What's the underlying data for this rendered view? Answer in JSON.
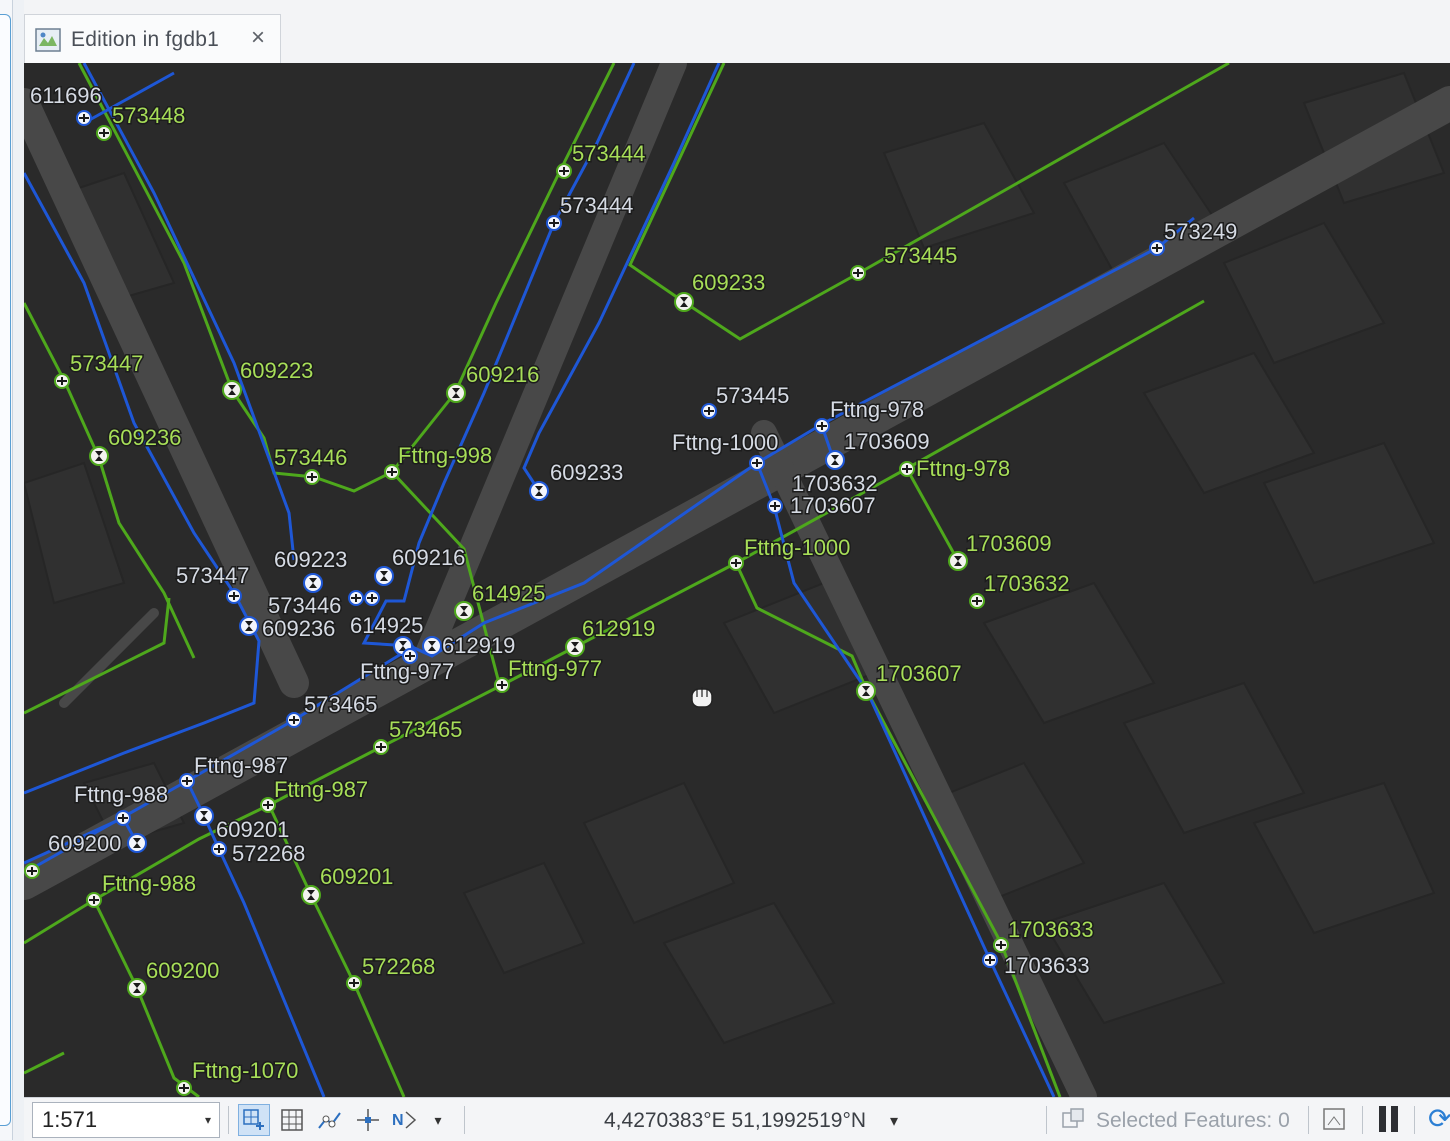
{
  "tab": {
    "title": "Edition in fgdb1",
    "close_glyph": "×",
    "icon": "map-icon"
  },
  "statusbar": {
    "scale": "1:571",
    "coordinates": "4,4270383°E 51,1992519°N",
    "selected_features": "Selected Features: 0"
  },
  "colors": {
    "map_background": "#2a2a2a",
    "road": "#4b4b4b",
    "green_line": "#4ea81c",
    "blue_line": "#1e57d6",
    "green_label": "#a7de58",
    "white_label": "#d6dbe4"
  },
  "map": {
    "green_labels": [
      "573448",
      "573444",
      "573445",
      "609233",
      "573447",
      "609223",
      "609216",
      "609236",
      "573446",
      "Fttng-998",
      "614925",
      "612919",
      "Fttng-977",
      "Fttng-1000",
      "Fttng-978",
      "1703609",
      "1703632",
      "1703607",
      "573465",
      "Fttng-987",
      "609201",
      "Fttng-988",
      "609200",
      "572268",
      "Fttng-1070",
      "1703633"
    ],
    "white_labels": [
      "611696",
      "573444",
      "573249",
      "573445",
      "Fttng-978",
      "Fttng-1000",
      "1703609",
      "609233",
      "1703632",
      "1703607",
      "609223",
      "609216",
      "573447",
      "573446",
      "609236",
      "614925",
      "612919",
      "Fttng-977",
      "573465",
      "Fttng-987",
      "Fttng-988",
      "609200",
      "609201",
      "572268",
      "1703633"
    ]
  }
}
